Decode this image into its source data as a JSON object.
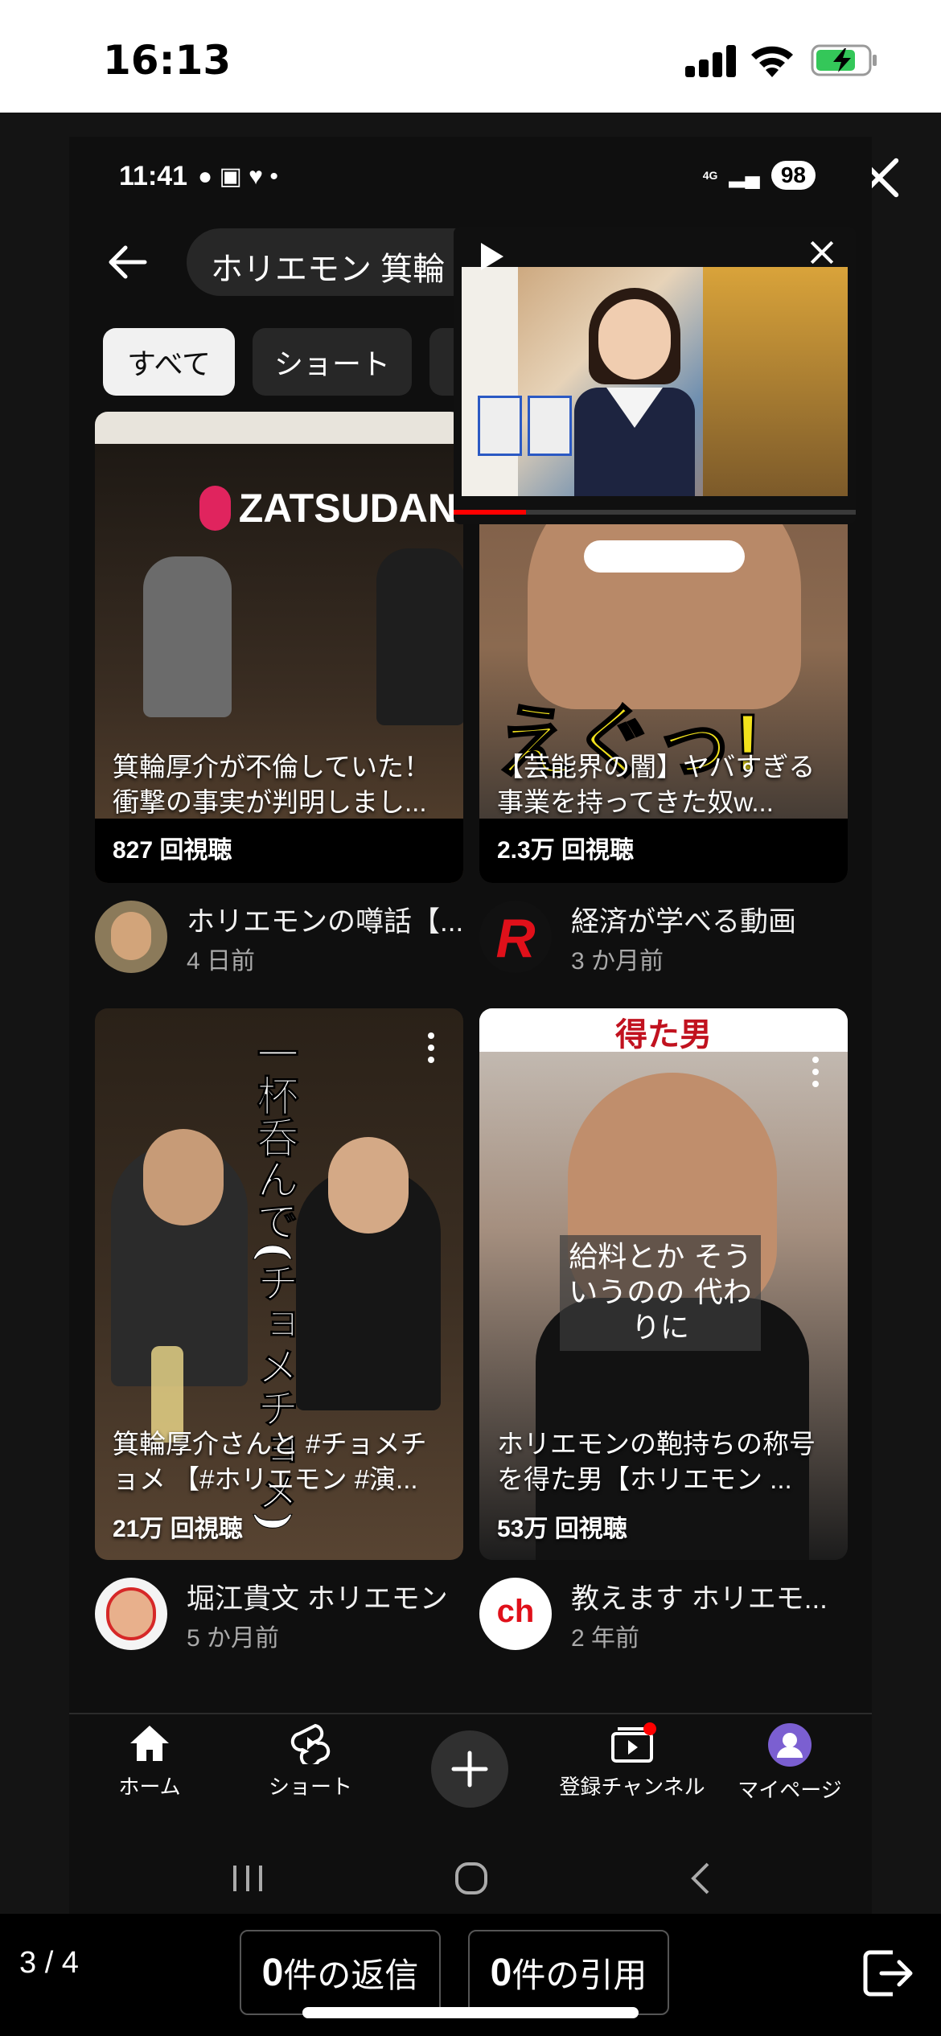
{
  "outer_status": {
    "time": "16:13"
  },
  "inner_status": {
    "time": "11:41",
    "network": "4G",
    "battery": "98"
  },
  "search": {
    "query": "ホリエモン 箕輪"
  },
  "filter_chips": [
    "すべて",
    "ショート"
  ],
  "pip": {
    "progress": 0.18
  },
  "videos": [
    {
      "thumb_banner": "ZATSUDAN",
      "title": "箕輪厚介が不倫していた！衝撃の事実が判明しまし...",
      "views": "827 回視聴",
      "channel": "ホリエモンの噂話【...",
      "age": "4 日前"
    },
    {
      "thumb_caption": "えぐっ!",
      "title": "【芸能界の闇】ヤバすぎる事業を持ってきた奴w...",
      "views": "2.3万 回視聴",
      "channel": "経済が学べる動画",
      "age": "3 か月前"
    },
    {
      "thumb_vertical": "一杯呑んで(チョメチョメ)",
      "title": "箕輪厚介さんと #チョメチョメ 【#ホリエモン #演...",
      "views": "21万 回視聴",
      "channel": "堀江貴文 ホリエモン",
      "age": "5 か月前"
    },
    {
      "thumb_top": "得た男",
      "thumb_caption": "給料とか そういうのの 代わりに",
      "title": "ホリエモンの鞄持ちの称号を得た男【ホリエモン ...",
      "views": "53万 回視聴",
      "channel": "教えます ホリエモ...",
      "age": "2 年前"
    }
  ],
  "avatar_text": {
    "channel2": "R",
    "channel4": "ch"
  },
  "bottom_nav": [
    {
      "label": "ホーム",
      "icon": "home-icon"
    },
    {
      "label": "ショート",
      "icon": "shorts-icon"
    },
    {
      "label": "",
      "icon": "create-icon"
    },
    {
      "label": "登録チャンネル",
      "icon": "subscriptions-icon"
    },
    {
      "label": "マイページ",
      "icon": "profile-icon"
    }
  ],
  "viewer": {
    "page": "3 / 4",
    "replies_count": "0",
    "replies_label": "件の返信",
    "quotes_count": "0",
    "quotes_label": "件の引用"
  },
  "colors": {
    "accent": "#ff0000",
    "chip_active_bg": "#f1f1f1",
    "avatar_purple": "#7b5fd1"
  }
}
